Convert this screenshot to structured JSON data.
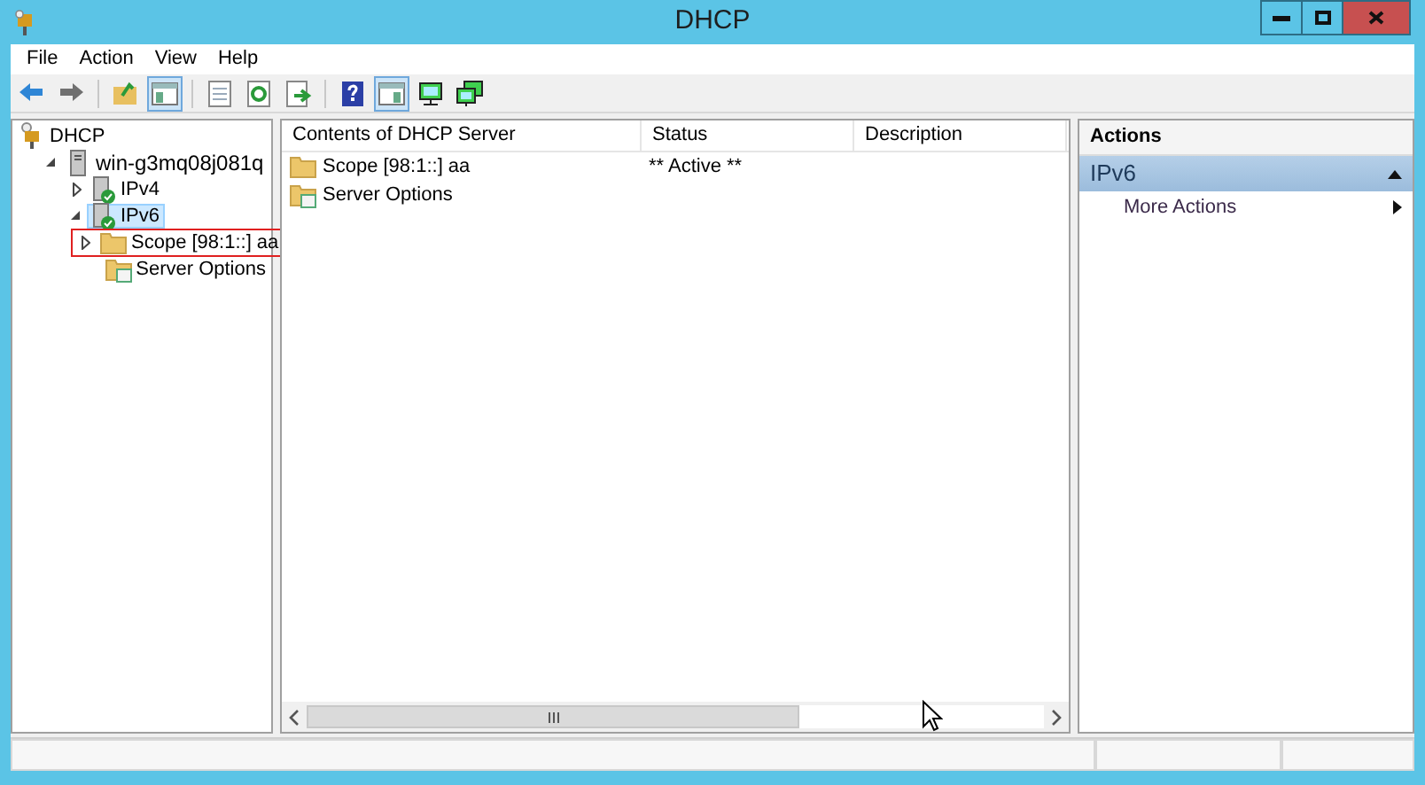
{
  "window": {
    "title": "DHCP"
  },
  "menu": [
    "File",
    "Action",
    "View",
    "Help"
  ],
  "toolbar": [
    {
      "kind": "back",
      "pressed": false
    },
    {
      "kind": "forward",
      "pressed": false
    },
    {
      "kind": "separator"
    },
    {
      "kind": "folder-up",
      "pressed": false
    },
    {
      "kind": "pane",
      "pressed": true
    },
    {
      "kind": "separator"
    },
    {
      "kind": "list",
      "pressed": false
    },
    {
      "kind": "refresh",
      "pressed": false
    },
    {
      "kind": "export",
      "pressed": false
    },
    {
      "kind": "separator"
    },
    {
      "kind": "help",
      "pressed": false
    },
    {
      "kind": "pane-right",
      "pressed": true
    },
    {
      "kind": "monitor",
      "pressed": false
    },
    {
      "kind": "monitors",
      "pressed": false
    }
  ],
  "tree": [
    {
      "label": "DHCP",
      "kind": "dhcp",
      "selected": false,
      "children": [
        {
          "label": "win-g3mq08j081q",
          "kind": "server",
          "expanded": true,
          "selected": false,
          "children": [
            {
              "label": "IPv4",
              "kind": "protocol",
              "expanded": false,
              "selected": false
            },
            {
              "label": "IPv6",
              "kind": "protocol",
              "expanded": true,
              "selected": true,
              "children": [
                {
                  "label": "Scope [98:1::] aa",
                  "kind": "folder",
                  "expanded": false,
                  "selected": false,
                  "marked": true
                },
                {
                  "label": "Server Options",
                  "kind": "options",
                  "selected": false,
                  "marked": false
                }
              ]
            }
          ]
        }
      ]
    }
  ],
  "table": {
    "columns": [
      "Contents of DHCP Server",
      "Status",
      "Description"
    ],
    "rows": [
      {
        "kind": "folder",
        "cells": [
          "Scope [98:1::] aa",
          "** Active **",
          ""
        ]
      },
      {
        "kind": "options",
        "cells": [
          "Server Options",
          "",
          ""
        ]
      }
    ]
  },
  "actions": {
    "title": "Actions",
    "sections": [
      {
        "title": "IPv6",
        "expanded": true,
        "items": [
          {
            "label": "More Actions",
            "submenu": true
          }
        ]
      }
    ]
  }
}
